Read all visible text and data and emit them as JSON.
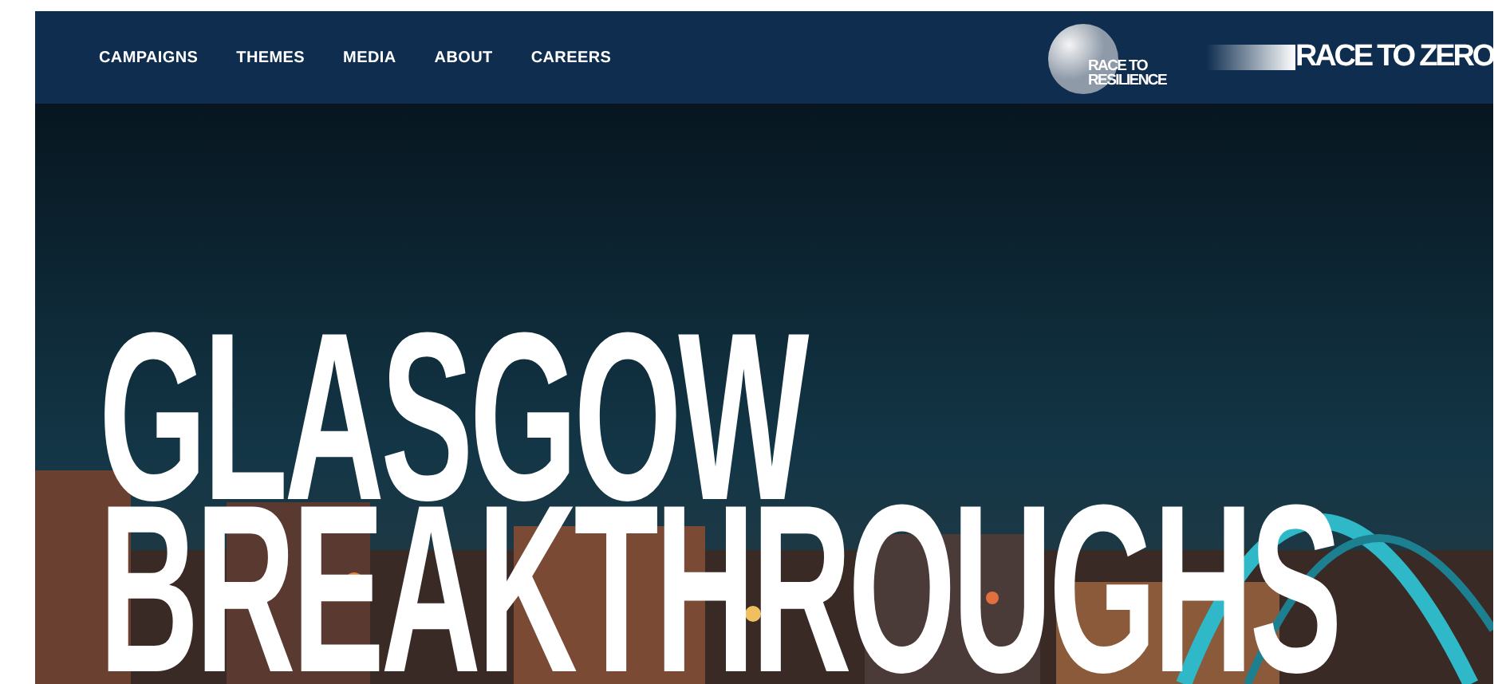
{
  "nav": {
    "items": [
      {
        "label": "CAMPAIGNS"
      },
      {
        "label": "THEMES"
      },
      {
        "label": "MEDIA"
      },
      {
        "label": "ABOUT"
      },
      {
        "label": "CAREERS"
      }
    ],
    "logos": [
      {
        "kind": "resilience",
        "lines": [
          "RACE TO",
          "RESILIENCE"
        ]
      },
      {
        "kind": "zero",
        "lines": [
          "RACE TO ZERO"
        ]
      }
    ]
  },
  "hero": {
    "headline": [
      "GLASGOW",
      "BREAKTHROUGHS"
    ]
  }
}
